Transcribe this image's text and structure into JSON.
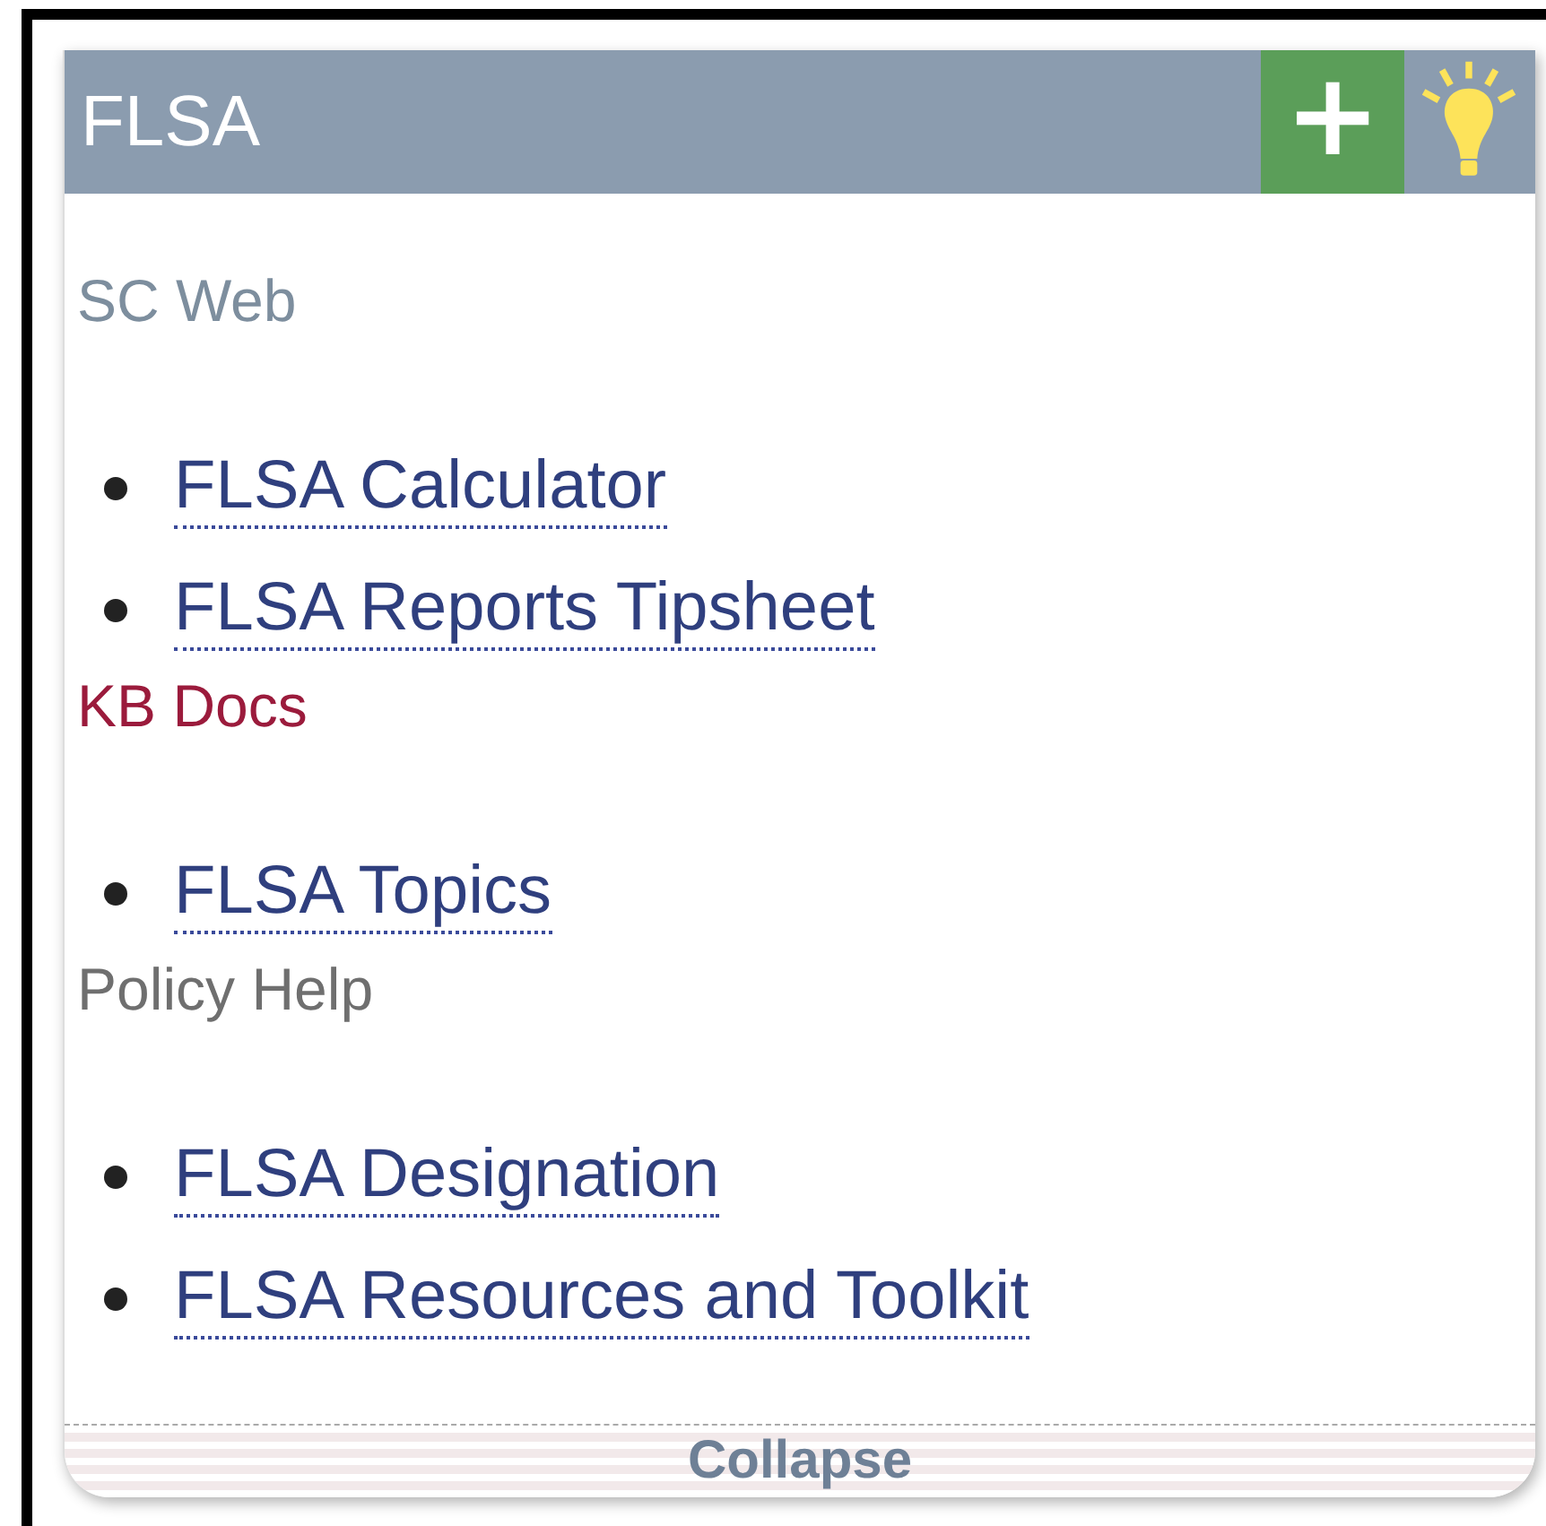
{
  "panel": {
    "title": "FLSA",
    "add_button": "+"
  },
  "sections": [
    {
      "heading": "SC Web",
      "color": "#7d8e9e",
      "links": [
        "FLSA Calculator",
        "FLSA Reports Tipsheet"
      ]
    },
    {
      "heading": "KB Docs",
      "color": "#9b1b3c",
      "links": [
        "FLSA Topics"
      ]
    },
    {
      "heading": "Policy Help",
      "color": "#6f6f6f",
      "links": [
        "FLSA Designation",
        "FLSA Resources and Toolkit"
      ]
    }
  ],
  "footer": {
    "label": "Collapse"
  }
}
